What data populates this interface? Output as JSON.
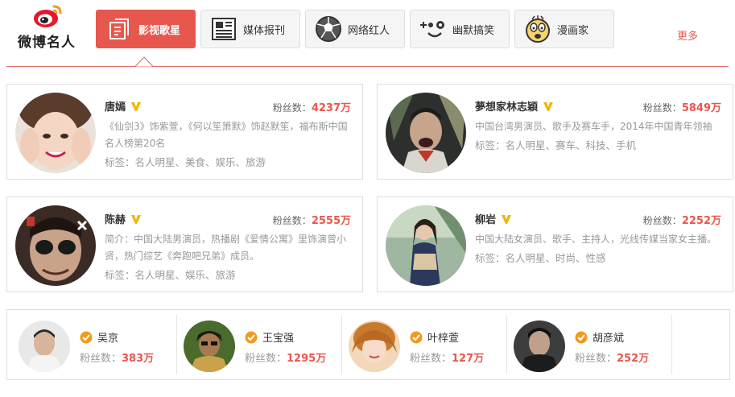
{
  "brand": {
    "name": "微博名人"
  },
  "tabs": [
    {
      "label": "影视歌星",
      "icon": "note-icon",
      "active": true
    },
    {
      "label": "媒体报刊",
      "icon": "newspaper-icon",
      "active": false
    },
    {
      "label": "网络红人",
      "icon": "soccer-ball-icon",
      "active": false
    },
    {
      "label": "幽默搞笑",
      "icon": "funny-face-icon",
      "active": false
    },
    {
      "label": "漫画家",
      "icon": "cartoon-face-icon",
      "active": false
    }
  ],
  "colors": {
    "accent": "#e8574d",
    "verified": "#f5b400",
    "orange_badge": "#f29a1e"
  },
  "cards": [
    {
      "name": "唐嫣",
      "fans_label": "粉丝数：",
      "fans": "4237万",
      "desc": "《仙剑3》饰紫萱，《何以笙箫默》饰赵默笙，福布斯中国名人榜第20名",
      "tags": "标签：名人明星、美食、娱乐、旅游"
    },
    {
      "name": "夢想家林志穎",
      "fans_label": "粉丝数：",
      "fans": "5849万",
      "desc": "中国台湾男演员、歌手及赛车手，2014年中国青年领袖",
      "tags": "标签：名人明星、赛车、科技、手机"
    },
    {
      "name": "陈赫",
      "fans_label": "粉丝数：",
      "fans": "2555万",
      "desc": "简介：中国大陆男演员，热播剧《爱情公寓》里饰演曾小贤，热门综艺《奔跑吧兄弟》成员。",
      "tags": "标签：名人明星、娱乐、旅游"
    },
    {
      "name": "柳岩",
      "fans_label": "粉丝数：",
      "fans": "2252万",
      "desc": "中国大陆女演员、歌手、主持人，光线传媒当家女主播。",
      "tags": "标签：名人明星、时尚、性感"
    }
  ],
  "minis": [
    {
      "name": "吴京",
      "fans_label": "粉丝数：",
      "fans": "383万"
    },
    {
      "name": "王宝强",
      "fans_label": "粉丝数：",
      "fans": "1295万"
    },
    {
      "name": "叶梓萱",
      "fans_label": "粉丝数：",
      "fans": "127万"
    },
    {
      "name": "胡彦斌",
      "fans_label": "粉丝数：",
      "fans": "252万"
    }
  ],
  "more_label": "更多"
}
